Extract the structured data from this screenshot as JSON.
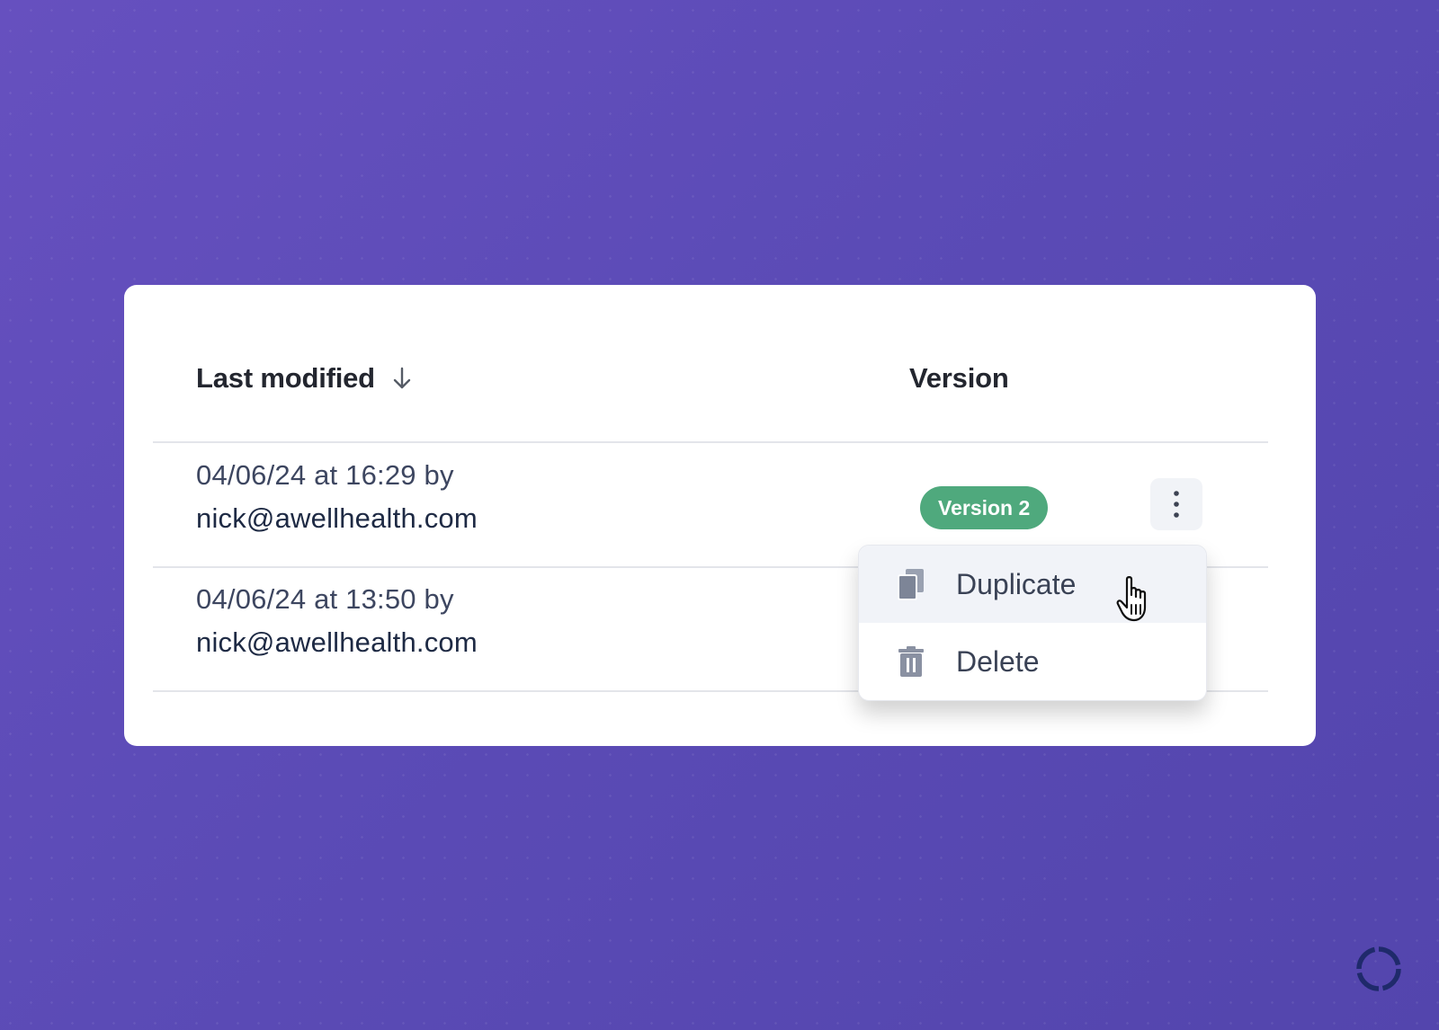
{
  "table": {
    "headers": {
      "last_modified": "Last modified",
      "version": "Version"
    },
    "rows": [
      {
        "date": "04/06/24 at 16:29 by",
        "email": "nick@awellhealth.com",
        "version_badge": "Version 2"
      },
      {
        "date": "04/06/24 at 13:50 by",
        "email": "nick@awellhealth.com"
      }
    ]
  },
  "context_menu": {
    "items": [
      {
        "label": "Duplicate",
        "icon": "duplicate-icon"
      },
      {
        "label": "Delete",
        "icon": "trash-icon"
      }
    ]
  },
  "icons": {
    "sort": "arrow-down-icon",
    "more": "more-vertical-icon",
    "cursor": "hand-pointer-cursor",
    "loader": "loading-ring-icon"
  },
  "colors": {
    "background": "#5b4bb6",
    "badge": "#4fa97d",
    "loader": "#1f2a6b"
  }
}
